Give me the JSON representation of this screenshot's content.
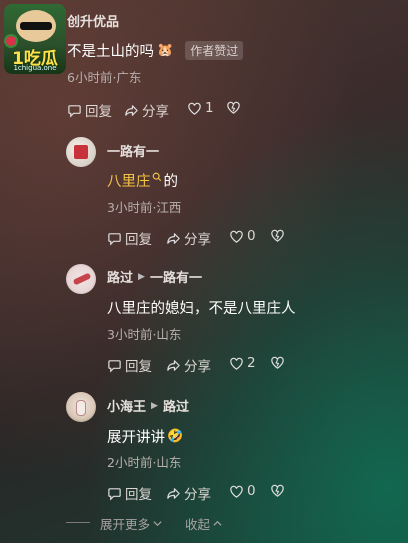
{
  "main_comment": {
    "author": "创升优品",
    "text": "不是土山的吗",
    "emoji": "🐹",
    "tag": "作者赞过",
    "meta": "6小时前·广东",
    "logo_text": "1吃瓜",
    "logo_url": "1chigua.one",
    "actions": {
      "reply": "回复",
      "share": "分享",
      "like_count": "1"
    }
  },
  "replies": [
    {
      "author": "一路有一",
      "reply_to": "",
      "text_link": "八里庄",
      "text_suffix": "的",
      "meta": "3小时前·江西",
      "actions": {
        "reply": "回复",
        "share": "分享",
        "like_count": "0"
      }
    },
    {
      "author": "路过",
      "reply_to": "一路有一",
      "text": "八里庄的媳妇，不是八里庄人",
      "meta": "3小时前·山东",
      "actions": {
        "reply": "回复",
        "share": "分享",
        "like_count": "2"
      }
    },
    {
      "author": "小海王",
      "reply_to": "路过",
      "text": "展开讲讲",
      "emoji": "🤣",
      "meta": "2小时前·山东",
      "actions": {
        "reply": "回复",
        "share": "分享",
        "like_count": "0"
      }
    }
  ],
  "footer": {
    "expand": "展开更多",
    "collapse": "收起"
  },
  "icons": [
    "reply-icon",
    "share-icon",
    "like-icon",
    "dislike-icon",
    "search-icon",
    "chevron-down-icon",
    "chevron-up-icon",
    "arrow-right-icon"
  ]
}
